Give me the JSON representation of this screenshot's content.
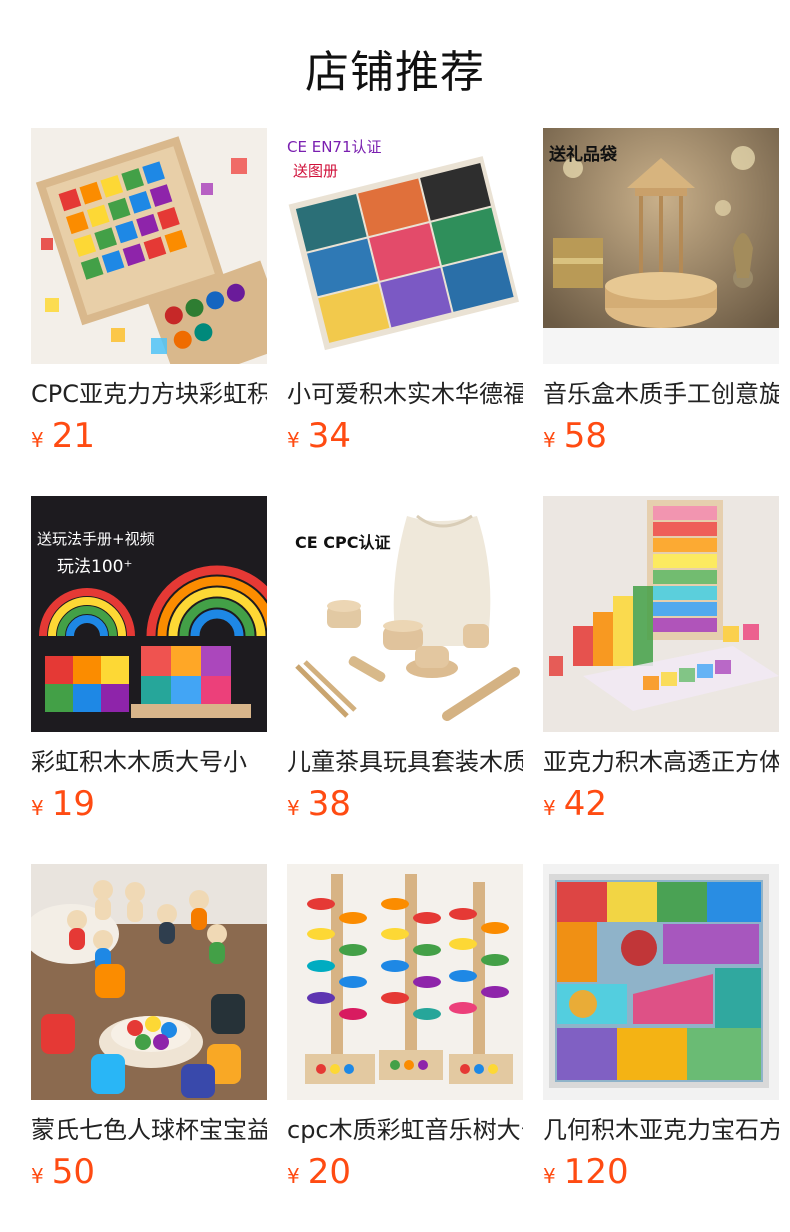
{
  "header": {
    "title": "店铺推荐"
  },
  "products": [
    {
      "name": "CPC亚克力方块彩虹积木",
      "currency": "¥",
      "price": "21",
      "badge": "",
      "badge2": "",
      "img": "acrylic-tray"
    },
    {
      "name": "小可爱积木实木华德福",
      "currency": "¥",
      "price": "34",
      "badge": "CE EN71认证",
      "badge2": "送图册",
      "img": "grains-box"
    },
    {
      "name": "音乐盒木质手工创意旋转",
      "currency": "¥",
      "price": "58",
      "badge": "送礼品袋",
      "badge2": "",
      "img": "music-box"
    },
    {
      "name": "彩虹积木木质大号小",
      "currency": "¥",
      "price": "19",
      "badge": "送玩法手册+视频",
      "badge2": "玩法100⁺",
      "img": "rainbow-arch"
    },
    {
      "name": "儿童茶具玩具套装木质",
      "currency": "¥",
      "price": "38",
      "badge": "CE CPC认证",
      "badge2": "",
      "img": "tea-set"
    },
    {
      "name": "亚克力积木高透正方体",
      "currency": "¥",
      "price": "42",
      "badge": "",
      "badge2": "",
      "img": "acrylic-cubes"
    },
    {
      "name": "蒙氏七色人球杯宝宝益智",
      "currency": "¥",
      "price": "50",
      "badge": "",
      "badge2": "",
      "img": "peg-cups"
    },
    {
      "name": "cpc木质彩虹音乐树大号",
      "currency": "¥",
      "price": "20",
      "badge": "",
      "badge2": "",
      "img": "music-tree"
    },
    {
      "name": "几何积木亚克力宝石方块",
      "currency": "¥",
      "price": "120",
      "badge": "",
      "badge2": "",
      "img": "gem-blocks"
    }
  ],
  "colors": {
    "price": "#ff4b12",
    "title": "#111111",
    "name": "#222222"
  }
}
